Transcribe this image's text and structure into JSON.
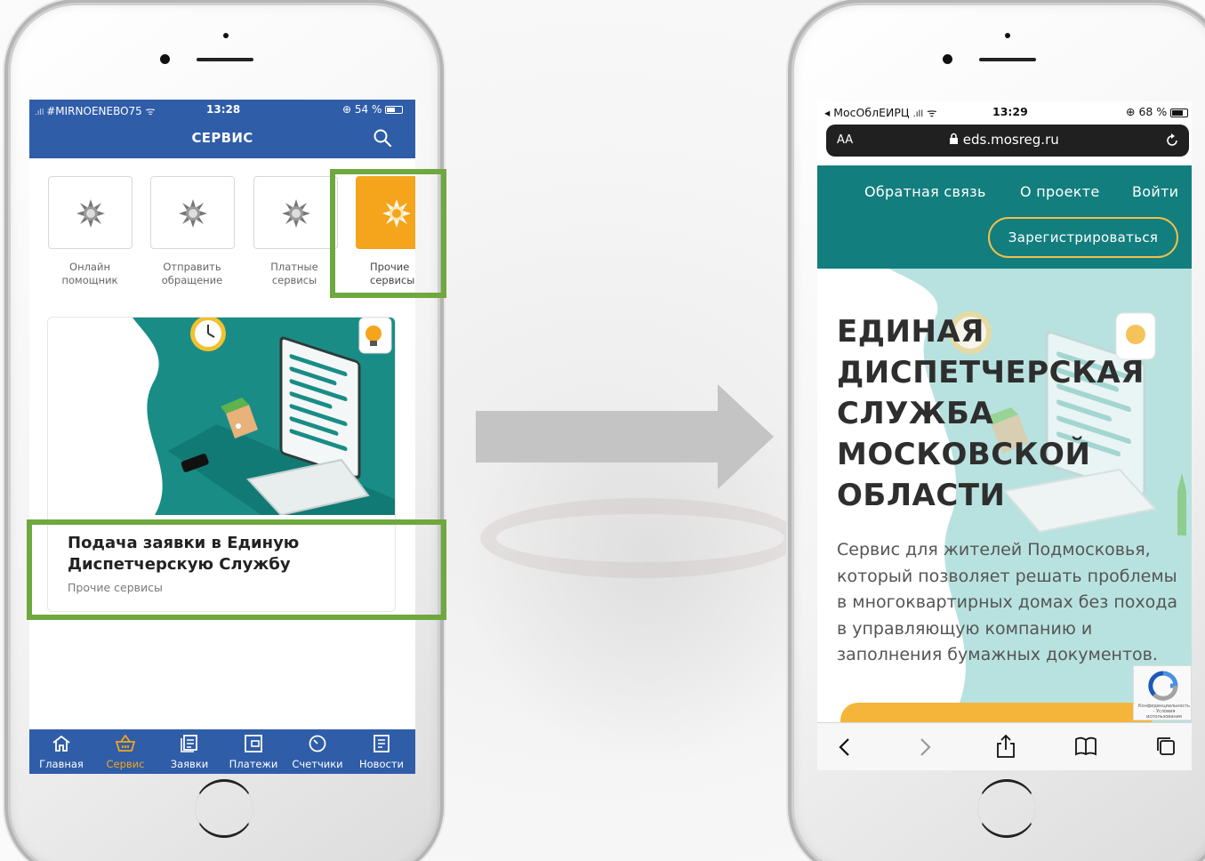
{
  "left_phone": {
    "status": {
      "carrier": "#MIRNOENEBO75",
      "time": "13:28",
      "battery": "54 %"
    },
    "header": {
      "title": "СЕРВИС"
    },
    "services": [
      {
        "label_line1": "Онлайн",
        "label_line2": "помощник"
      },
      {
        "label_line1": "Отправить",
        "label_line2": "обращение"
      },
      {
        "label_line1": "Платные",
        "label_line2": "сервисы"
      },
      {
        "label_line1": "Прочие",
        "label_line2": "сервисы",
        "active": true
      }
    ],
    "card": {
      "title": "Подача заявки в Единую Диспетчерскую Службу",
      "subtitle": "Прочие сервисы"
    },
    "tabs": [
      {
        "label": "Главная",
        "icon": "home-icon"
      },
      {
        "label": "Сервис",
        "icon": "basket-icon",
        "active": true
      },
      {
        "label": "Заявки",
        "icon": "requests-icon"
      },
      {
        "label": "Платежи",
        "icon": "wallet-icon"
      },
      {
        "label": "Счетчики",
        "icon": "meter-icon"
      },
      {
        "label": "Новости",
        "icon": "news-icon"
      }
    ]
  },
  "right_phone": {
    "status": {
      "carrier": "◂ МосОблЕИРЦ",
      "time": "13:29",
      "battery": "68 %"
    },
    "url_bar": {
      "text_size": "AA",
      "url": "eds.mosreg.ru"
    },
    "nav": {
      "feedback": "Обратная связь",
      "about": "О проекте",
      "login": "Войти",
      "register": "Зарегистрироваться"
    },
    "hero": {
      "title": "ЕДИНАЯ ДИСПЕТЧЕРСКАЯ СЛУЖБА МОСКОВСКОЙ ОБЛАСТИ",
      "description": "Сервис для жителей Подмосковья, который позволяет решать проблемы в многоквартирных домах без похода в управляющую компанию и заполнения бумажных документов."
    },
    "recaptcha_caption": "Конфиденциальность - Условия использования"
  },
  "colors": {
    "app_blue": "#2f5da8",
    "accent_orange": "#f4a51c",
    "teal": "#137e7e",
    "highlight_green": "#6fa83f",
    "arrow_gray": "#c4c4c4"
  }
}
